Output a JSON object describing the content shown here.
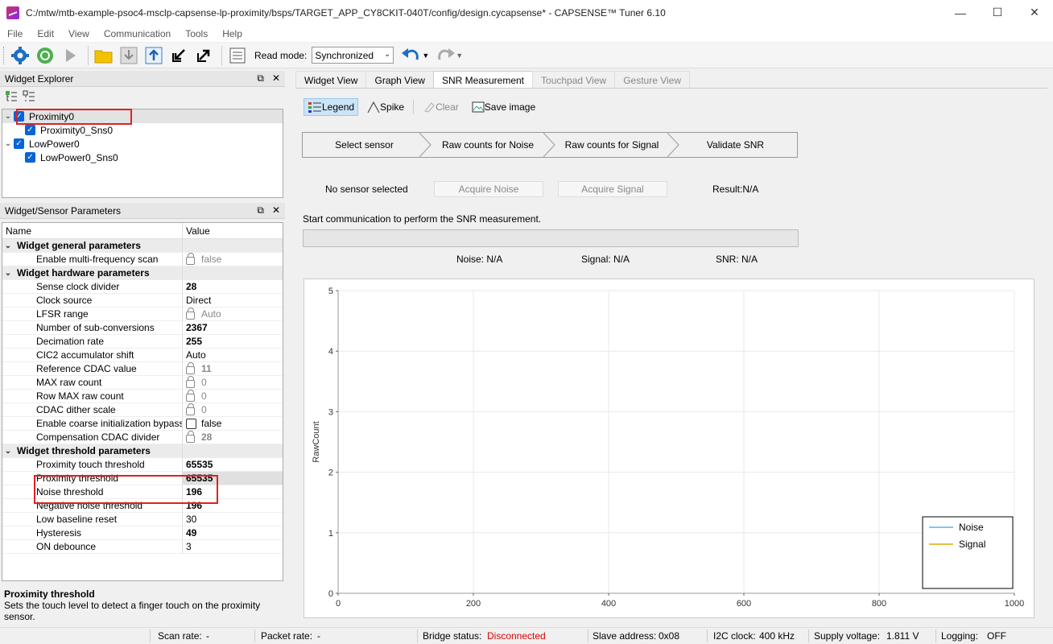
{
  "window": {
    "title": "C:/mtw/mtb-example-psoc4-msclp-capsense-lp-proximity/bsps/TARGET_APP_CY8CKIT-040T/config/design.cycapsense* - CAPSENSE™ Tuner 6.10",
    "minimize": "—",
    "maximize": "☐",
    "close": "✕"
  },
  "menu": [
    "File",
    "Edit",
    "View",
    "Communication",
    "Tools",
    "Help"
  ],
  "toolbar": {
    "read_mode_label": "Read mode:",
    "read_mode_value": "Synchronized"
  },
  "widget_explorer": {
    "title": "Widget Explorer",
    "tree": [
      {
        "label": "Proximity0",
        "children": [
          "Proximity0_Sns0"
        ]
      },
      {
        "label": "LowPower0",
        "children": [
          "LowPower0_Sns0"
        ]
      }
    ]
  },
  "params": {
    "title": "Widget/Sensor Parameters",
    "col_name": "Name",
    "col_value": "Value",
    "cat_general": "Widget general parameters",
    "cat_hardware": "Widget hardware parameters",
    "cat_threshold": "Widget threshold parameters",
    "rows": {
      "multifreq": {
        "name": "Enable multi-frequency scan",
        "value": "false"
      },
      "sense_clk": {
        "name": "Sense clock divider",
        "value": "28"
      },
      "clk_src": {
        "name": "Clock source",
        "value": "Direct"
      },
      "lfsr": {
        "name": "LFSR range",
        "value": "Auto"
      },
      "subconv": {
        "name": "Number of sub-conversions",
        "value": "2367"
      },
      "decim": {
        "name": "Decimation rate",
        "value": "255"
      },
      "cic2": {
        "name": "CIC2 accumulator shift",
        "value": "Auto"
      },
      "refcdac": {
        "name": "Reference CDAC value",
        "value": "11"
      },
      "maxraw": {
        "name": "MAX raw count",
        "value": "0"
      },
      "rowmax": {
        "name": "Row MAX raw count",
        "value": "0"
      },
      "dither": {
        "name": "CDAC dither scale",
        "value": "0"
      },
      "coarse": {
        "name": "Enable coarse initialization bypass",
        "value": "false"
      },
      "compcdac": {
        "name": "Compensation CDAC divider",
        "value": "28"
      },
      "prox_touch": {
        "name": "Proximity touch threshold",
        "value": "65535"
      },
      "prox_th": {
        "name": "Proximity threshold",
        "value": "65535"
      },
      "noise_th": {
        "name": "Noise threshold",
        "value": "196"
      },
      "neg_noise": {
        "name": "Negative noise threshold",
        "value": "196"
      },
      "low_base": {
        "name": "Low baseline reset",
        "value": "30"
      },
      "hyst": {
        "name": "Hysteresis",
        "value": "49"
      },
      "on_deb": {
        "name": "ON debounce",
        "value": "3"
      }
    }
  },
  "description": {
    "title": "Proximity threshold",
    "text": "Sets the touch level to detect a finger touch on the proximity sensor."
  },
  "tabs": [
    "Widget View",
    "Graph View",
    "SNR Measurement",
    "Touchpad View",
    "Gesture View"
  ],
  "snr": {
    "legend": "Legend",
    "spike": "Spike",
    "clear": "Clear",
    "save_image": "Save image",
    "steps": [
      "Select sensor",
      "Raw counts for Noise",
      "Raw counts for Signal",
      "Validate SNR"
    ],
    "no_sensor": "No sensor selected",
    "acquire_noise": "Acquire Noise",
    "acquire_signal": "Acquire Signal",
    "result": "Result:N/A",
    "message": "Start communication to perform the SNR measurement.",
    "noise": "Noise:  N/A",
    "signal": "Signal:  N/A",
    "snr_value": "SNR:  N/A"
  },
  "chart_data": {
    "type": "line",
    "ylabel": "RawCount",
    "xlabel": "",
    "xlim": [
      0,
      1000
    ],
    "ylim": [
      0,
      5
    ],
    "x_ticks": [
      "0",
      "200",
      "400",
      "600",
      "800",
      "1000"
    ],
    "y_ticks": [
      "0",
      "1",
      "2",
      "3",
      "4",
      "5"
    ],
    "grid": true,
    "legend_position": "bottom-right",
    "series": [
      {
        "name": "Noise",
        "color": "#5ab4e5",
        "values": []
      },
      {
        "name": "Signal",
        "color": "#e0a800",
        "values": []
      }
    ]
  },
  "statusbar": {
    "scan_rate_label": "Scan rate:",
    "scan_rate": "-",
    "packet_rate_label": "Packet rate:",
    "packet_rate": "-",
    "bridge_label": "Bridge status:",
    "bridge": "Disconnected",
    "slave_label": "Slave address:",
    "slave": "0x08",
    "i2c_label": "I2C clock:",
    "i2c": "400 kHz",
    "supply_label": "Supply voltage:",
    "supply": "1.811 V",
    "logging_label": "Logging:",
    "logging": "OFF"
  }
}
